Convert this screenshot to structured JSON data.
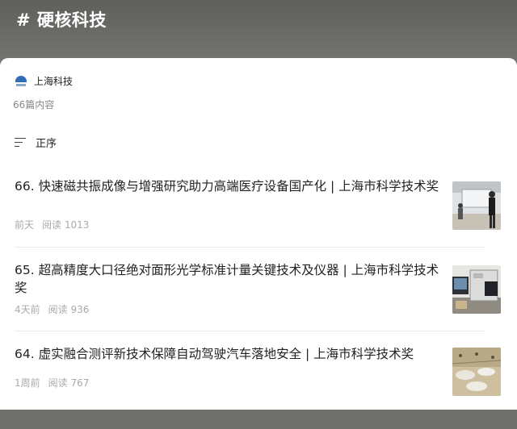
{
  "topic": {
    "title": "# 硬核科技"
  },
  "account": {
    "name": "上海科技",
    "logo_icon": "shanghai-tech-logo"
  },
  "content_count": "66篇内容",
  "sort": {
    "icon": "sort-icon",
    "label": "正序"
  },
  "articles": [
    {
      "title": "66. 快速磁共振成像与增强研究助力高端医疗设备国产化 | 上海市科学技术奖",
      "time": "前天",
      "reads_label": "阅读",
      "reads": "1013"
    },
    {
      "title": "65. 超高精度大口径绝对面形光学标准计量关键技术及仪器 | 上海市科学技术奖",
      "time": "4天前",
      "reads_label": "阅读",
      "reads": "936"
    },
    {
      "title": "64. 虚实融合测评新技术保障自动驾驶汽车落地安全 | 上海市科学技术奖",
      "time": "1周前",
      "reads_label": "阅读",
      "reads": "767"
    }
  ]
}
